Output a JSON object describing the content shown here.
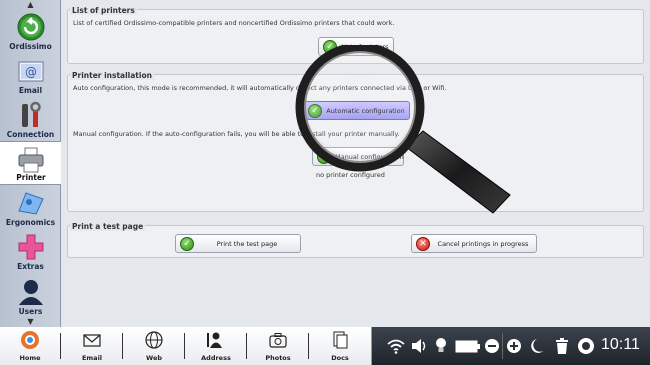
{
  "sidebar": {
    "items": [
      {
        "label": "Ordissimo",
        "icon": "back-arrow-icon"
      },
      {
        "label": "Email",
        "icon": "email-settings-icon"
      },
      {
        "label": "Connection",
        "icon": "tools-icon"
      },
      {
        "label": "Printer",
        "icon": "printer-icon"
      },
      {
        "label": "Ergonomics",
        "icon": "ergonomics-icon"
      },
      {
        "label": "Extras",
        "icon": "plus-icon"
      },
      {
        "label": "Users",
        "icon": "user-icon"
      }
    ],
    "up_arrow": "▲",
    "down_arrow": "▼"
  },
  "list_printers": {
    "title": "List of printers",
    "description": "List of certified Ordissimo-compatible printers and noncertified Ordissimo printers that could work.",
    "button_label": "List of printers"
  },
  "installation": {
    "title": "Printer installation",
    "auto_text": "Auto configuration, this mode is recommended, it will automatically detect any printers connected via USB or Wifi.",
    "auto_button": "Automatic configuration",
    "manual_text": "Manual configuration. If the auto-configuration fails, you will be able to install your printer manually.",
    "manual_button": "Manual configuration",
    "status": "no printer configured"
  },
  "test_page": {
    "title": "Print a test page",
    "print_button": "Print the test page",
    "cancel_button": "Cancel printings in progress"
  },
  "taskbar": {
    "items": [
      {
        "label": "Home",
        "icon": "home-icon"
      },
      {
        "label": "Email",
        "icon": "envelope-icon"
      },
      {
        "label": "Web",
        "icon": "globe-icon"
      },
      {
        "label": "Address",
        "icon": "address-book-icon"
      },
      {
        "label": "Photos",
        "icon": "camera-icon"
      },
      {
        "label": "Docs",
        "icon": "documents-icon"
      }
    ],
    "clock": "10:11"
  },
  "colors": {
    "sidebar_bg": "#c4ccd8",
    "main_bg": "#e4e7ec",
    "highlight_button": "#a9a4f5",
    "ok_green": "#2f8a1d",
    "cancel_red": "#c41c10",
    "taskbar_dark": "#2a3038"
  }
}
